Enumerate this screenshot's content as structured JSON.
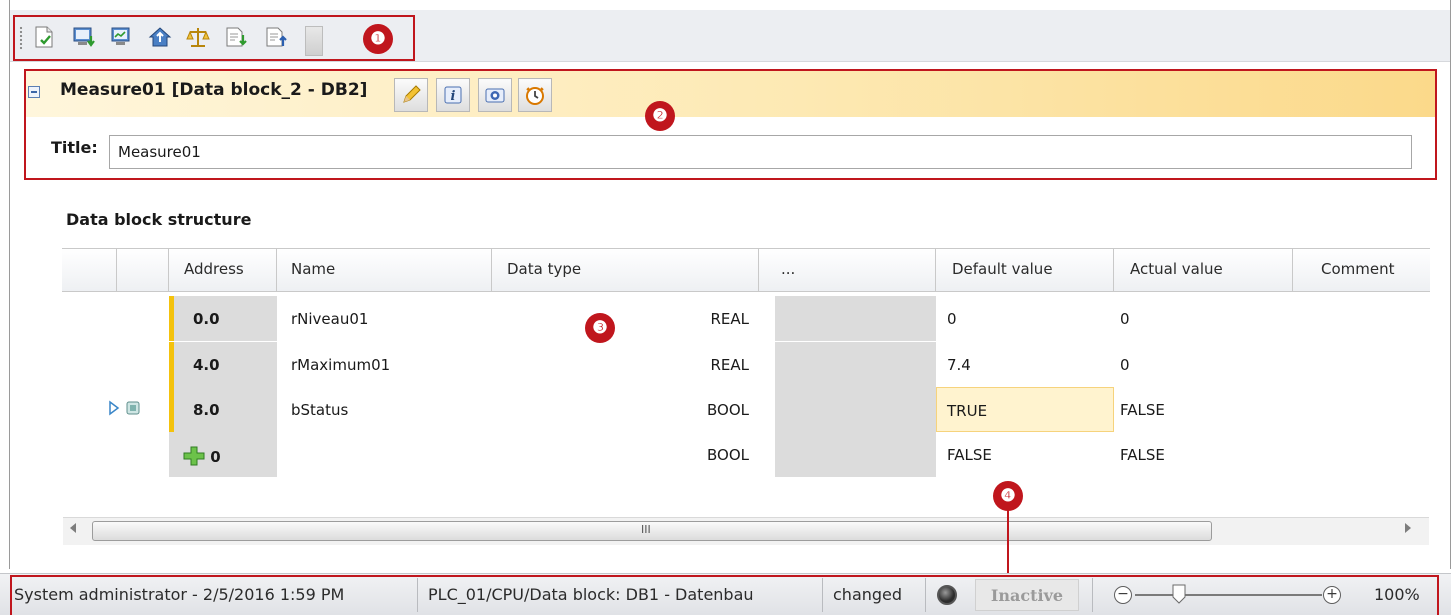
{
  "toolbar": {
    "buttons": [
      {
        "icon": "checkin-document-icon"
      },
      {
        "icon": "monitor-download-icon"
      },
      {
        "icon": "monitor-upload-icon"
      },
      {
        "icon": "house-upload-icon"
      },
      {
        "icon": "compare-scale-icon"
      },
      {
        "icon": "document-import-icon"
      },
      {
        "icon": "document-export-icon"
      }
    ],
    "callout": "❶"
  },
  "block": {
    "title": "Measure01 [Data block_2 - DB2]",
    "callout": "❷",
    "title_label": "Title:",
    "title_value": "Measure01"
  },
  "structure": {
    "heading": "Data block structure",
    "callout": "❸",
    "columns": [
      "Address",
      "Name",
      "Data type",
      "...",
      "Default value",
      "Actual value",
      "Comment"
    ],
    "rows": [
      {
        "address": "0.0",
        "name": "rNiveau01",
        "data_type": "REAL",
        "default_value": "0",
        "actual_value": "0",
        "comment": ""
      },
      {
        "address": "4.0",
        "name": "rMaximum01",
        "data_type": "REAL",
        "default_value": "7.4",
        "actual_value": "0",
        "comment": ""
      },
      {
        "address": "8.0",
        "name": "bStatus",
        "data_type": "BOOL",
        "default_value": "TRUE",
        "actual_value": "FALSE",
        "comment": ""
      },
      {
        "address": "0",
        "name": "",
        "data_type": "BOOL",
        "default_value": "FALSE",
        "actual_value": "FALSE",
        "comment": ""
      }
    ],
    "scroll_grip": "III"
  },
  "status": {
    "callout": "❹",
    "user": "System administrator - 2/5/2016 1:59 PM",
    "path": "PLC_01/CPU/Data block: DB1 - Datenbau",
    "state": "changed",
    "mode": "Inactive",
    "zoom": "100%",
    "zoom_out": "−",
    "zoom_in": "+"
  },
  "colors": {
    "callout_red": "#c0161d",
    "address_marker": "#f4c20d",
    "header_gold": "#fbd98a"
  }
}
